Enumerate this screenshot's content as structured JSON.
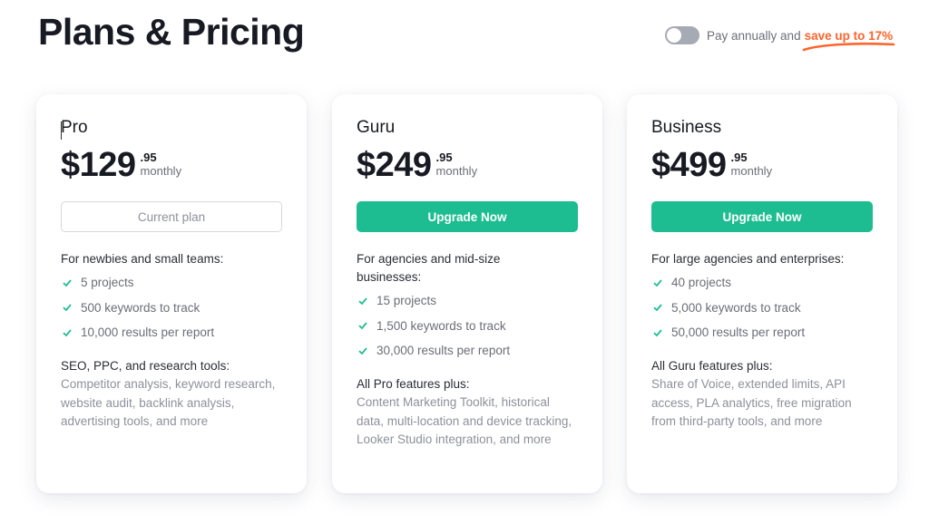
{
  "header": {
    "title": "Plans & Pricing",
    "billing_toggle": {
      "state": "off",
      "label": "Pay annually and",
      "highlight": "save up to 17%",
      "highlight_color": "#ff642d"
    }
  },
  "colors": {
    "accent": "#1ebd91",
    "text_primary": "#171a22",
    "text_secondary": "#6c6e79"
  },
  "plans": [
    {
      "name": "Pro",
      "price_main": "$129",
      "price_cents": ".95",
      "period": "monthly",
      "button_label": "Current plan",
      "button_type": "current",
      "audience": "For newbies and small teams:",
      "features": [
        "5 projects",
        "500 keywords to track",
        "10,000 results per report"
      ],
      "extra_title": "SEO, PPC, and research tools:",
      "extra_desc": "Competitor analysis, keyword research, website audit, backlink analysis, advertising tools, and more"
    },
    {
      "name": "Guru",
      "price_main": "$249",
      "price_cents": ".95",
      "period": "monthly",
      "button_label": "Upgrade Now",
      "button_type": "upgrade",
      "audience": "For agencies and mid-size businesses:",
      "features": [
        "15 projects",
        "1,500 keywords to track",
        "30,000 results per report"
      ],
      "extra_title": "All Pro features plus:",
      "extra_desc": "Content Marketing Toolkit, historical data, multi-location and device tracking, Looker Studio integration, and more"
    },
    {
      "name": "Business",
      "price_main": "$499",
      "price_cents": ".95",
      "period": "monthly",
      "button_label": "Upgrade Now",
      "button_type": "upgrade",
      "audience": "For large agencies and enterprises:",
      "features": [
        "40 projects",
        "5,000 keywords to track",
        "50,000 results per report"
      ],
      "extra_title": "All Guru features plus:",
      "extra_desc": "Share of Voice, extended limits, API access, PLA analytics, free migration from third-party tools, and more"
    }
  ]
}
